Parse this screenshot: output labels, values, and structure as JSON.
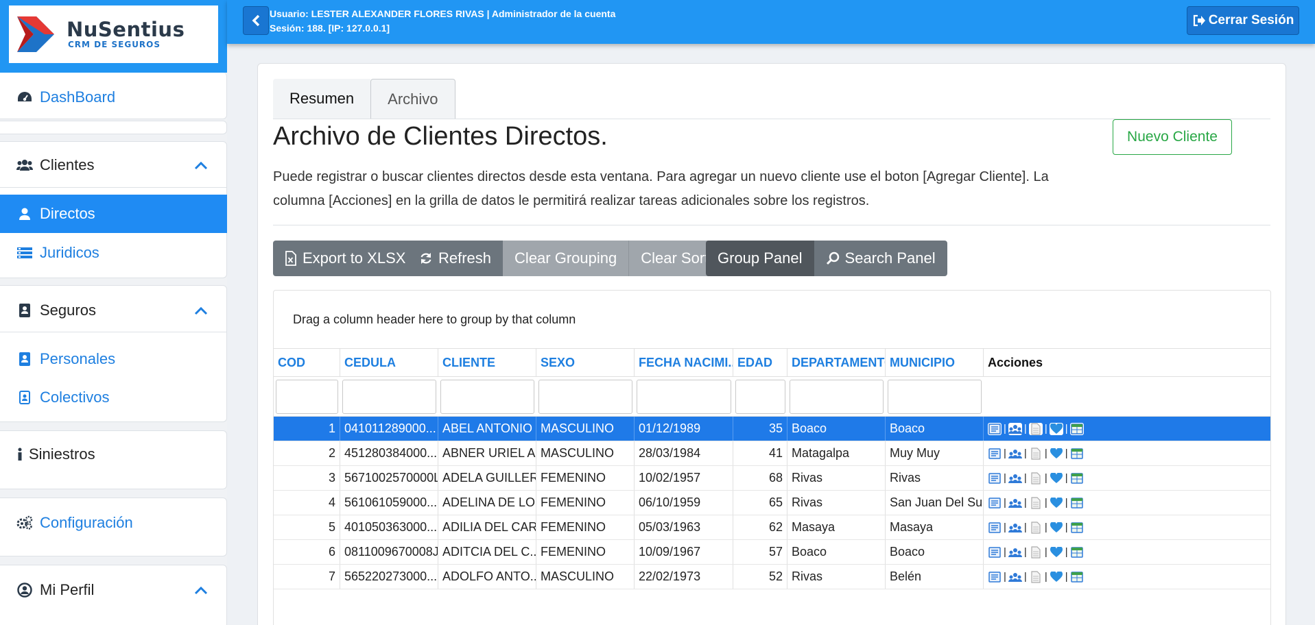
{
  "brand": {
    "name": "NuSentius",
    "tagline": "CRM DE SEGUROS"
  },
  "sidebar": {
    "dashboard": "DashBoard",
    "clientes": {
      "label": "Clientes",
      "items": [
        {
          "label": "Directos"
        },
        {
          "label": "Juridicos"
        }
      ]
    },
    "seguros": {
      "label": "Seguros",
      "items": [
        {
          "label": "Personales"
        },
        {
          "label": "Colectivos"
        }
      ]
    },
    "siniestros": "Siniestros",
    "configuracion": "Configuración",
    "perfil": "Mi Perfil"
  },
  "topbar": {
    "user_line": "Usuario: LESTER ALEXANDER FLORES RIVAS | Administrador de la cuenta",
    "session_line": "Sesión: 188. [IP: 127.0.0.1]",
    "logout": "Cerrar Sesión"
  },
  "tabs": [
    {
      "label": "Resumen"
    },
    {
      "label": "Archivo"
    }
  ],
  "page": {
    "title": "Archivo de Clientes Directos.",
    "new_button": "Nuevo Cliente",
    "description": "Puede registrar o buscar clientes directos desde esta ventana. Para agregar un nuevo cliente use el boton [Agregar Cliente]. La columna [Acciones] en la grilla de datos le permitirá realizar tareas adicionales sobre los registros."
  },
  "toolbar": {
    "export": "Export to XLSX",
    "refresh": "Refresh",
    "clear_grouping": "Clear Grouping",
    "clear_sorting": "Clear Sorting",
    "group_panel": "Group Panel",
    "search_panel": "Search Panel"
  },
  "grid": {
    "group_hint": "Drag a column header here to group by that column",
    "columns": [
      "COD",
      "CEDULA",
      "CLIENTE",
      "SEXO",
      "FECHA NACIMI...",
      "EDAD",
      "DEPARTAMENTO",
      "MUNICIPIO",
      "Acciones"
    ],
    "rows": [
      [
        "1",
        "041011289000...",
        "ABEL ANTONIO ...",
        "MASCULINO",
        "01/12/1989",
        "35",
        "Boaco",
        "Boaco"
      ],
      [
        "2",
        "451280384000...",
        "ABNER URIEL AL...",
        "MASCULINO",
        "28/03/1984",
        "41",
        "Matagalpa",
        "Muy Muy"
      ],
      [
        "3",
        "5671002570000L",
        "ADELA GUILLER...",
        "FEMENINO",
        "10/02/1957",
        "68",
        "Rivas",
        "Rivas"
      ],
      [
        "4",
        "561061059000...",
        "ADELINA DE LO...",
        "FEMENINO",
        "06/10/1959",
        "65",
        "Rivas",
        "San Juan Del Sur"
      ],
      [
        "5",
        "401050363000...",
        "ADILIA DEL CAR...",
        "FEMENINO",
        "05/03/1963",
        "62",
        "Masaya",
        "Masaya"
      ],
      [
        "6",
        "0811009670008J",
        "ADITCIA DEL C...",
        "FEMENINO",
        "10/09/1967",
        "57",
        "Boaco",
        "Boaco"
      ],
      [
        "7",
        "565220273000...",
        "ADOLFO ANTO...",
        "MASCULINO",
        "22/02/1973",
        "52",
        "Rivas",
        "Belén"
      ]
    ],
    "action_separator": "|"
  },
  "colors": {
    "primary": "#2196f3",
    "accent": "#1e7fe0",
    "success": "#28a745",
    "selected_row": "#1f7ae8"
  }
}
